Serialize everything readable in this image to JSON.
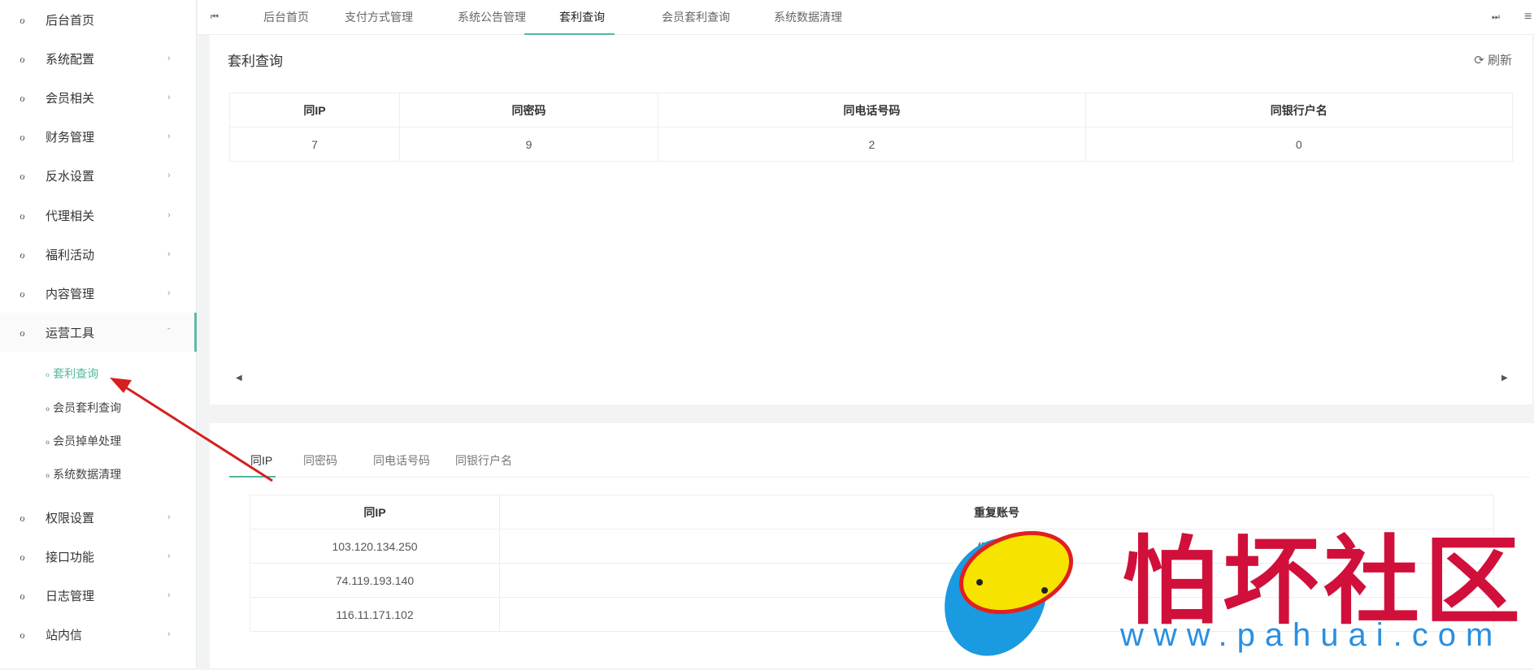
{
  "sidebar": {
    "items": [
      {
        "label": "后台首页",
        "icon": "circle-icon"
      },
      {
        "label": "系统配置"
      },
      {
        "label": "会员相关"
      },
      {
        "label": "财务管理"
      },
      {
        "label": "反水设置"
      },
      {
        "label": "代理相关"
      },
      {
        "label": "福利活动"
      },
      {
        "label": "内容管理"
      },
      {
        "label": "运营工具"
      }
    ],
    "sub": [
      {
        "label": "套利查询"
      },
      {
        "label": "会员套利查询"
      },
      {
        "label": "会员掉单处理"
      },
      {
        "label": "系统数据清理"
      }
    ],
    "items2": [
      {
        "label": "权限设置"
      },
      {
        "label": "接口功能"
      },
      {
        "label": "日志管理"
      },
      {
        "label": "站内信"
      }
    ],
    "chevron": "›",
    "chevron_open": "ˇ",
    "icon": "ℴ"
  },
  "tabs": [
    {
      "label": "后台首页"
    },
    {
      "label": "支付方式管理"
    },
    {
      "label": "系统公告管理"
    },
    {
      "label": "套利查询"
    },
    {
      "label": "会员套利查询"
    },
    {
      "label": "系统数据清理"
    }
  ],
  "tab_close": "×",
  "tab_prev": "⏮",
  "tab_next": "⏭",
  "menu_icon": "≡",
  "card1": {
    "title": "套利查询",
    "refresh": "⟳ 刷新",
    "headers": [
      "同IP",
      "同密码",
      "同电话号码",
      "同银行户名"
    ],
    "values": [
      "7",
      "9",
      "2",
      "0"
    ]
  },
  "card2": {
    "tabs": [
      "同IP",
      "同密码",
      "同电话号码",
      "同银行户名"
    ],
    "headers": [
      "同IP",
      "重复账号"
    ],
    "rows": [
      [
        "103.120.134.250",
        "ff...00..."
      ],
      [
        "74.119.193.140",
        "ca..."
      ],
      [
        "116.11.171.102",
        ""
      ]
    ]
  },
  "watermark": {
    "text": "怕坏社区",
    "url": "www.pahuai.com"
  },
  "colors": {
    "accent": "#4fb8a0",
    "watermark_red": "#d0103a",
    "watermark_blue": "#2a8fe0"
  }
}
